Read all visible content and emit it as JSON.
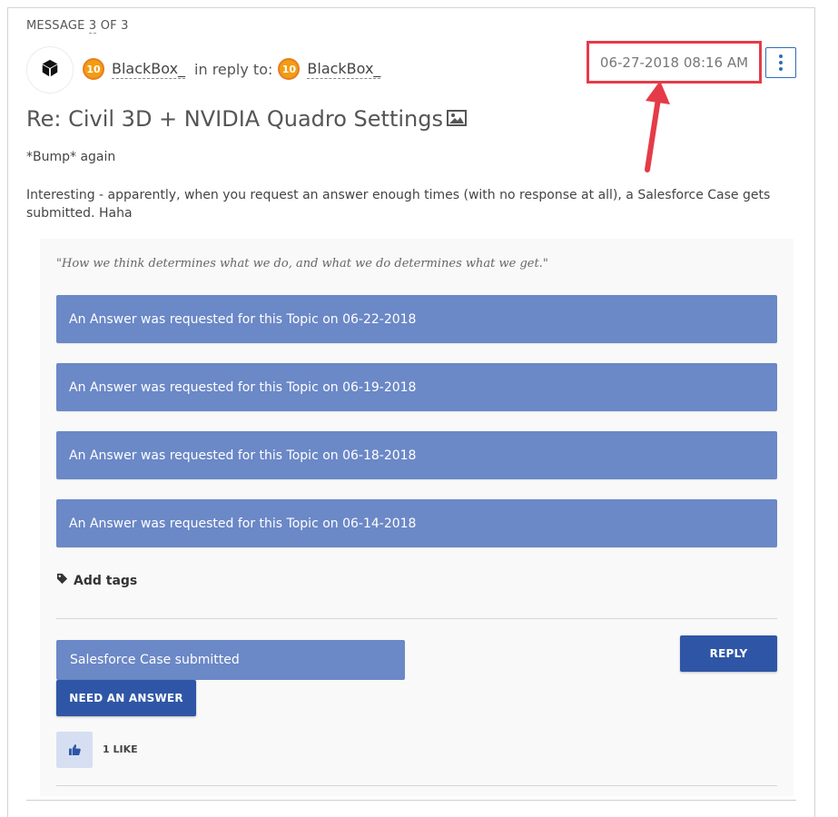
{
  "header": {
    "message_label_prefix": "MESSAGE",
    "message_index": "3",
    "message_label_suffix": "OF 3"
  },
  "author": {
    "rank": "10",
    "name": "BlackBox_",
    "reply_label": "in reply to:",
    "reply_rank": "10",
    "reply_name": "BlackBox_"
  },
  "post": {
    "date": "06-27-2018 08:16 AM",
    "title": "Re: Civil 3D + NVIDIA Quadro Settings",
    "line1": "*Bump* again",
    "line2": "Interesting - apparently, when you request an answer enough times (with no response at all), a Salesforce Case gets submitted. Haha"
  },
  "signature": {
    "quote": "\"How we think determines what we do, and what we do determines what we get.\"",
    "requests": [
      "An Answer was requested for this Topic on 06-22-2018",
      "An Answer was requested for this Topic on 06-19-2018",
      "An Answer was requested for this Topic on 06-18-2018",
      "An Answer was requested for this Topic on 06-14-2018"
    ]
  },
  "actions": {
    "add_tags": "Add tags",
    "salesforce": "Salesforce Case submitted",
    "reply": "REPLY",
    "need_answer": "NEED AN ANSWER",
    "likes": "1 LIKE"
  },
  "icons": {
    "avatar": "cube-icon",
    "options": "kebab-menu-icon",
    "title_image": "image-icon",
    "tag": "tag-icon",
    "like": "thumbs-up-icon",
    "annotation": "red-arrow-icon"
  },
  "colors": {
    "banner": "#6b88c7",
    "button": "#2f56a6",
    "annotation": "#e53b48",
    "rank_badge": "#f39c12"
  }
}
